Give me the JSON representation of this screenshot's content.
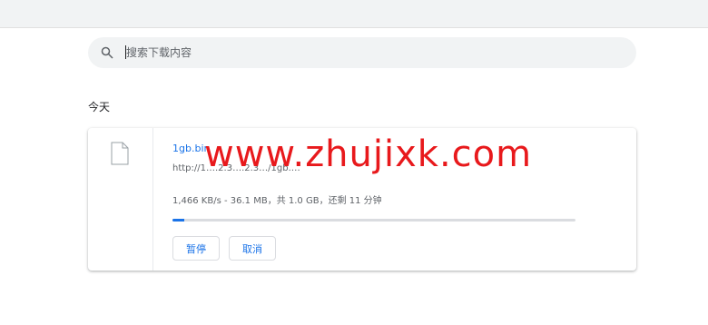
{
  "search": {
    "placeholder": "搜索下载内容"
  },
  "downloads": {
    "date_header": "今天",
    "item": {
      "file_name": "1gb.bin",
      "url": "http://1….2.3….2.3…/1gb.…",
      "status": "1,466 KB/s - 36.1 MB，共 1.0 GB，还剩 11 分钟",
      "progress_fraction": 0.03,
      "pause_label": "暂停",
      "cancel_label": "取消"
    }
  },
  "watermark": {
    "text": "www.zhujixk.com"
  },
  "colors": {
    "accent": "#1a73e8",
    "watermark": "#e8191c",
    "topbar": "#f1f3f4"
  }
}
